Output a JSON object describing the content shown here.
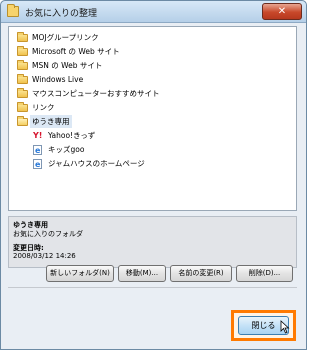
{
  "window": {
    "title": "お気に入りの整理",
    "close_glyph": "✕"
  },
  "tree": {
    "items": [
      {
        "label": "MOJグループリンク",
        "kind": "folder"
      },
      {
        "label": "Microsoft の Web サイト",
        "kind": "folder"
      },
      {
        "label": "MSN の Web サイト",
        "kind": "folder"
      },
      {
        "label": "Windows Live",
        "kind": "folder"
      },
      {
        "label": "マウスコンピューターおすすめサイト",
        "kind": "folder"
      },
      {
        "label": "リンク",
        "kind": "folder"
      },
      {
        "label": "ゆうき専用",
        "kind": "folder-open",
        "selected": true
      },
      {
        "label": "Yahoo!きっず",
        "kind": "link-yahoo",
        "yahoo_mark": "Y!"
      },
      {
        "label": "キッズgoo",
        "kind": "link"
      },
      {
        "label": "ジャムハウスのホームページ",
        "kind": "link"
      }
    ]
  },
  "info": {
    "name": "ゆうき専用",
    "type": "お気に入りのフォルダ",
    "modified_label": "変更日時:",
    "modified_value": "2008/03/12 14:26"
  },
  "buttons": {
    "new_folder": "新しいフォルダ(N)",
    "move": "移動(M)...",
    "rename": "名前の変更(R)",
    "delete": "削除(D)...",
    "close": "閉じる"
  },
  "colors": {
    "highlight": "#ff7a00"
  }
}
